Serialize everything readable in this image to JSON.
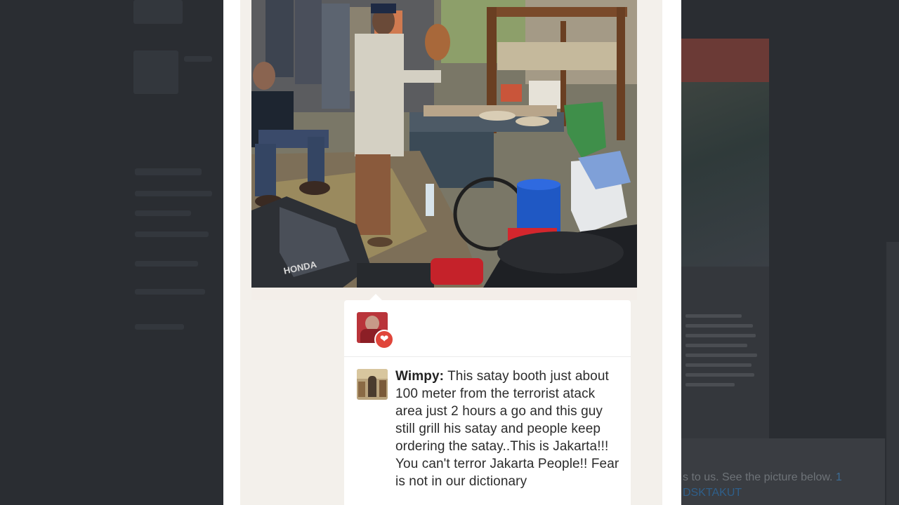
{
  "post": {
    "photo_alt": "Satay vendor grilling at a street stall with crowd and Honda motorbike",
    "motorbike_brand": "HONDA"
  },
  "likes": {
    "heart_icon": "heart-icon"
  },
  "comment": {
    "author": "Wimpy:",
    "text": "This satay booth just about 100 meter from the terrorist atack area just 2 hours a go and this guy still grill his satay and people keep ordering the satay..This is Jakarta!!! You can't terror Jakarta People!! Fear is not in our dictionary"
  },
  "background": {
    "bottom_text_pre": "s to us. See the picture below. ",
    "bottom_text_link": "1",
    "bottom_link": "DSKTAKUT"
  },
  "colors": {
    "overlay": "#2b2e33",
    "modal_bg": "#ffffff",
    "panel_bg": "#f3f0eb",
    "heart": "#e0453a",
    "text": "#2c2c2c"
  }
}
